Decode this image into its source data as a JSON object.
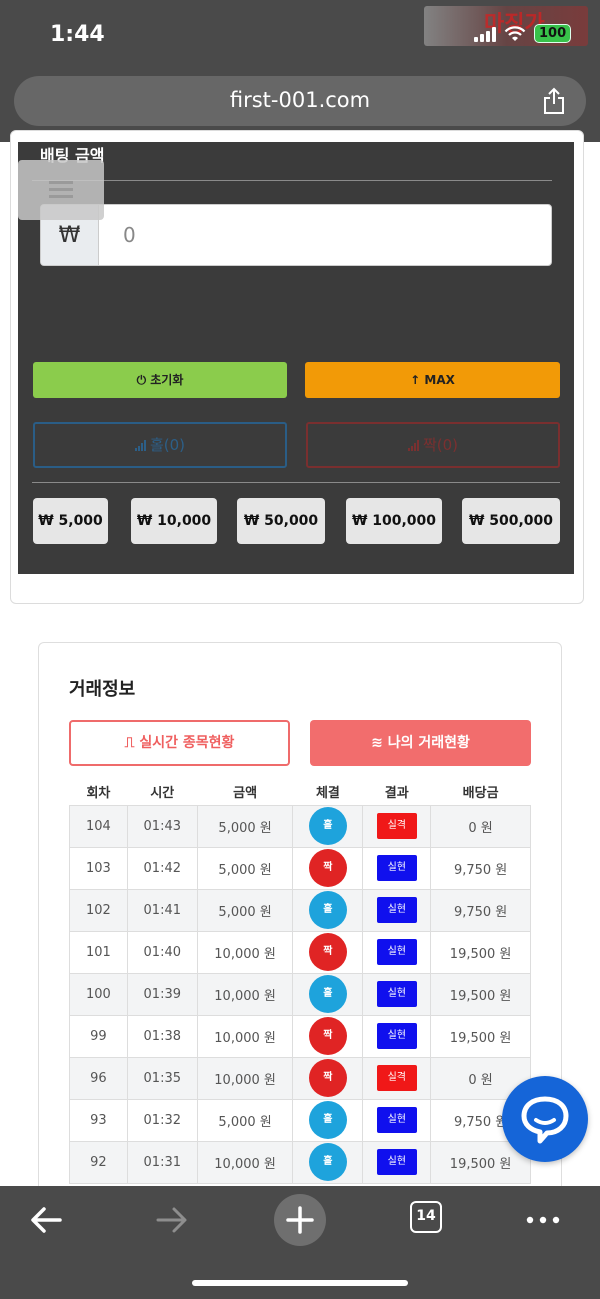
{
  "status_bar": {
    "time": "1:44",
    "battery": "100",
    "logo_text": "마징가"
  },
  "browser": {
    "url": "first-001.com",
    "tabs_count": "14"
  },
  "betting": {
    "title": "배팅 금액",
    "currency_symbol": "₩",
    "amount_value": "0",
    "reset_label": "⏻ 초기화",
    "max_label": "↑ MAX",
    "hol_label": "홀(0)",
    "jjak_label": "짝(0)",
    "chips": [
      "₩ 5,000",
      "₩ 10,000",
      "₩ 50,000",
      "₩ 100,000",
      "₩ 500,000"
    ]
  },
  "trade": {
    "title": "거래정보",
    "tab_live_label": "⎍ 실시간 종목현황",
    "tab_mine_label": "≋ 나의 거래현황",
    "columns": [
      "회차",
      "시간",
      "금액",
      "체결",
      "결과",
      "배당금"
    ],
    "rows": [
      {
        "round": "104",
        "time": "01:43",
        "amount": "5,000 원",
        "pick": "홀",
        "result": "실격",
        "payout": "0 원"
      },
      {
        "round": "103",
        "time": "01:42",
        "amount": "5,000 원",
        "pick": "짝",
        "result": "실현",
        "payout": "9,750 원"
      },
      {
        "round": "102",
        "time": "01:41",
        "amount": "5,000 원",
        "pick": "홀",
        "result": "실현",
        "payout": "9,750 원"
      },
      {
        "round": "101",
        "time": "01:40",
        "amount": "10,000 원",
        "pick": "짝",
        "result": "실현",
        "payout": "19,500 원"
      },
      {
        "round": "100",
        "time": "01:39",
        "amount": "10,000 원",
        "pick": "홀",
        "result": "실현",
        "payout": "19,500 원"
      },
      {
        "round": "99",
        "time": "01:38",
        "amount": "10,000 원",
        "pick": "짝",
        "result": "실현",
        "payout": "19,500 원"
      },
      {
        "round": "96",
        "time": "01:35",
        "amount": "10,000 원",
        "pick": "짝",
        "result": "실격",
        "payout": "0 원"
      },
      {
        "round": "93",
        "time": "01:32",
        "amount": "5,000 원",
        "pick": "홀",
        "result": "실현",
        "payout": "9,750 원"
      },
      {
        "round": "92",
        "time": "01:31",
        "amount": "10,000 원",
        "pick": "홀",
        "result": "실현",
        "payout": "19,500 원"
      }
    ]
  },
  "colors": {
    "hol": "#1ea3dc",
    "jjak": "#e02424",
    "realized": "#1010ee",
    "disqualified": "#f01818"
  },
  "icons": [
    "share-icon",
    "menu-icon",
    "power-icon",
    "arrow-up-icon",
    "signal-bars-icon",
    "chat-icon",
    "back-arrow-icon",
    "forward-arrow-icon",
    "plus-icon",
    "tabs-icon",
    "more-icon"
  ]
}
